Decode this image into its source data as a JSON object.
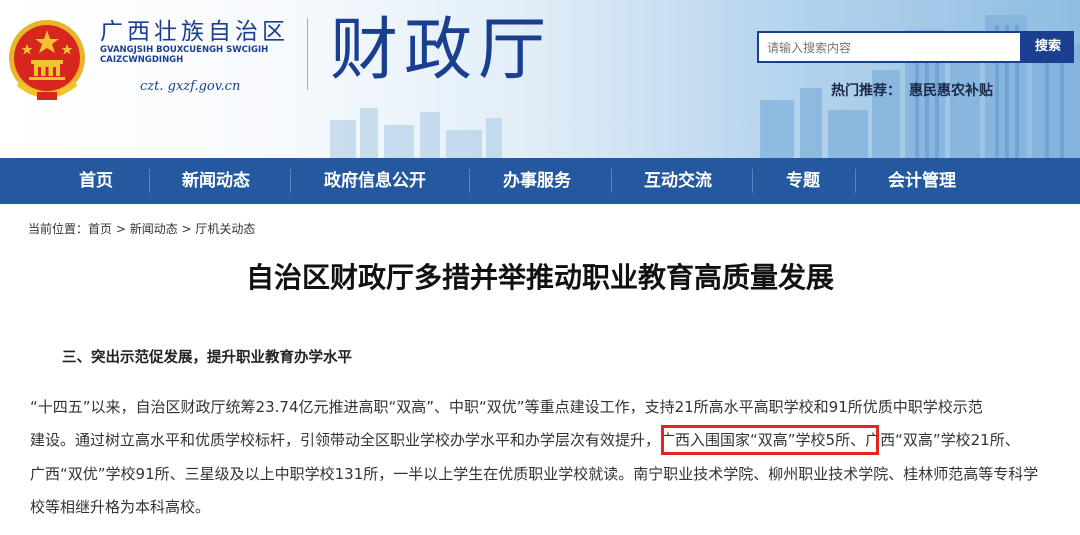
{
  "header": {
    "region_cn": "广西壮族自治区",
    "region_za": "GVANGJSIH BOUXCUENGH SWCIGIH CAIZCWNGDINGH",
    "domain": "czt. gxzf.gov.cn",
    "dept_name": "财政厅",
    "search": {
      "placeholder": "请输入搜索内容",
      "button_label": "搜索"
    },
    "hot": {
      "label": "热门推荐：",
      "link": "惠民惠农补贴"
    }
  },
  "nav": {
    "items": [
      {
        "label": "首页"
      },
      {
        "label": "新闻动态"
      },
      {
        "label": "政府信息公开"
      },
      {
        "label": "办事服务"
      },
      {
        "label": "互动交流"
      },
      {
        "label": "专题"
      },
      {
        "label": "会计管理"
      }
    ]
  },
  "breadcrumb": {
    "prefix": "当前位置：",
    "items": [
      "首页",
      "新闻动态",
      "厅机关动态"
    ],
    "separator": " > "
  },
  "article": {
    "title": "自治区财政厅多措并举推动职业教育高质量发展",
    "section_heading": "三、突出示范促发展，提升职业教育办学水平",
    "lines": [
      "“十四五”以来，自治区财政厅统筹23.74亿元推进高职“双高”、中职“双优”等重点建设工作，支持21所高水平高职学校和91所优质中职学校示范",
      "建设。通过树立高水平和优质学校标杆，引领带动全区职业学校办学水平和办学层次有效提升，广西入围国家“双高”学校5所、广西“双高”学校21所、",
      "广西“双优”学校91所、三星级及以上中职学校131所，一半以上学生在优质职业学校就读。南宁职业技术学院、柳州职业技术学院、桂林师范高等专科学",
      "校等相继升格为本科高校。"
    ]
  },
  "colors": {
    "brand_blue": "#1b3f8f",
    "nav_blue": "#24589f",
    "highlight_red": "#e0261f",
    "emblem_red": "#d7261e",
    "emblem_gold": "#f2c230"
  },
  "icons": {
    "emblem": "national-emblem-icon"
  }
}
